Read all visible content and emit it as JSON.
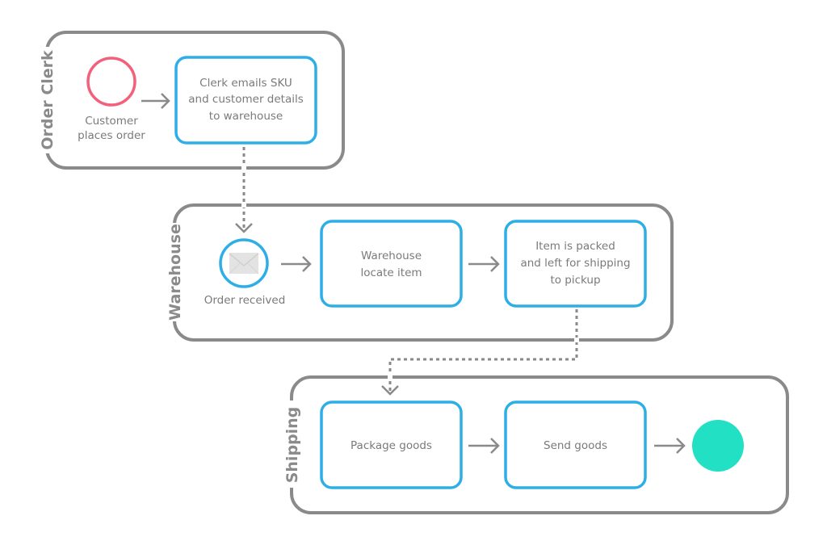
{
  "diagram": {
    "type": "bpmn-process",
    "colors": {
      "lane_border": "#8a8a8a",
      "task_border": "#2eaee6",
      "start_event": "#f2607a",
      "message_event": "#2eaee6",
      "end_event": "#22e0c4",
      "text": "#7a7a7a",
      "envelope": "#e3e3e3"
    },
    "lanes": [
      {
        "id": "order-clerk",
        "title": "Order Clerk",
        "elements": [
          {
            "id": "start",
            "kind": "start-event",
            "label_lines": [
              "Customer",
              "places order"
            ]
          },
          {
            "id": "task-email",
            "kind": "task",
            "lines": [
              "Clerk emails SKU",
              "and customer details",
              "to warehouse"
            ]
          }
        ]
      },
      {
        "id": "warehouse",
        "title": "Warehouse",
        "elements": [
          {
            "id": "msg-received",
            "kind": "message-start-event",
            "icon": "envelope-icon",
            "label_lines": [
              "Order received"
            ]
          },
          {
            "id": "task-locate",
            "kind": "task",
            "lines": [
              "Warehouse",
              "locate item"
            ]
          },
          {
            "id": "task-packed",
            "kind": "task",
            "lines": [
              "Item is packed",
              "and left for shipping",
              "to pickup"
            ]
          }
        ]
      },
      {
        "id": "shipping",
        "title": "Shipping",
        "elements": [
          {
            "id": "task-package",
            "kind": "task",
            "lines": [
              "Package goods"
            ]
          },
          {
            "id": "task-send",
            "kind": "task",
            "lines": [
              "Send goods"
            ]
          },
          {
            "id": "end",
            "kind": "end-event"
          }
        ]
      }
    ],
    "flows": [
      {
        "from": "start",
        "to": "task-email",
        "kind": "sequence"
      },
      {
        "from": "task-email",
        "to": "msg-received",
        "kind": "message"
      },
      {
        "from": "msg-received",
        "to": "task-locate",
        "kind": "sequence"
      },
      {
        "from": "task-locate",
        "to": "task-packed",
        "kind": "sequence"
      },
      {
        "from": "task-packed",
        "to": "task-package",
        "kind": "message"
      },
      {
        "from": "task-package",
        "to": "task-send",
        "kind": "sequence"
      },
      {
        "from": "task-send",
        "to": "end",
        "kind": "sequence"
      }
    ]
  }
}
